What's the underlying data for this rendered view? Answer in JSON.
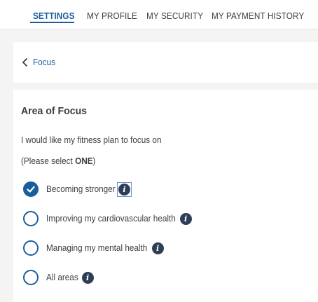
{
  "tabs": [
    {
      "label": "SETTINGS",
      "active": true
    },
    {
      "label": "MY PROFILE",
      "active": false
    },
    {
      "label": "MY SECURITY",
      "active": false
    },
    {
      "label": "MY PAYMENT HISTORY",
      "active": false
    }
  ],
  "breadcrumb": {
    "back_label": "Focus",
    "icon": "chevron-left-icon"
  },
  "focus": {
    "title": "Area of Focus",
    "prompt": "I would like my fitness plan to focus on",
    "hint_prefix": "(Please select ",
    "hint_emphasis": "ONE",
    "hint_suffix": ")",
    "options": [
      {
        "label": "Becoming stronger",
        "selected": true
      },
      {
        "label": "Improving my cardiovascular health",
        "selected": false
      },
      {
        "label": "Managing my mental health",
        "selected": false
      },
      {
        "label": "All areas",
        "selected": false
      }
    ],
    "info_icon": "info-icon",
    "info_glyph": "i"
  },
  "colors": {
    "accent": "#1b5e9e",
    "info": "#2f3e57",
    "background": "#f4f4f4"
  }
}
